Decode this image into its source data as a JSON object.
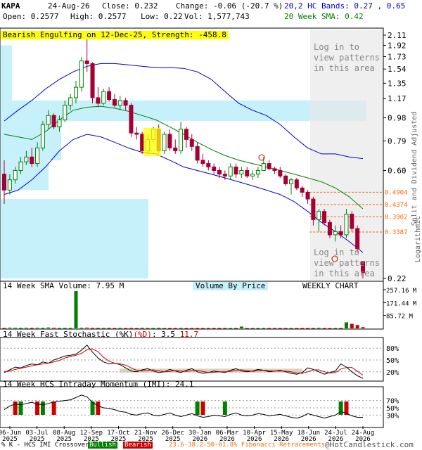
{
  "header": {
    "symbol": "KAPA",
    "date": "24-Aug-26",
    "close_label": "Close: 0.232",
    "change_label": "Change: -0.06 (-20.7 %)",
    "open_label": "Open: 0.2577",
    "high_label": "High: 0.2577",
    "low_label": "Low: 0.22",
    "vol_label": "Vol: 1,577,743",
    "bands_label": "20,2 HC Bands: 0.27 , 0.65",
    "sma_label": "20 Week SMA: 0.42",
    "pattern_banner": "Bearish Engulfing on 12-Dec-25, Strength: -458.8"
  },
  "overlay": {
    "login_top": [
      "Log in to",
      "view patterns",
      "in this area"
    ],
    "login_bottom": [
      "Log in to",
      "view patterns",
      "in this area"
    ]
  },
  "labels": {
    "right_axis_1": "Split and Dividend Adjusted",
    "right_axis_2": "Logarithmic",
    "volume_title": "14 Week SMA Volume: 7.95 M",
    "vbp_title": "Volume By Price",
    "weekly": "WEEKLY CHART",
    "stoch_title_a": "14 Week Fast Stochastic (%K)",
    "stoch_title_b": "(%D)",
    "stoch_title_c": ": 3.5",
    "stoch_title_d": "11.7",
    "imi_title": "14 Week HCS Intraday Momentum (IMI): 24.1",
    "footer_a": "% K - HCS IMI Crossover:",
    "footer_bullish": "Bullish",
    "footer_bearish": "Bearish",
    "footer_fib": "23.6-38.2-50-61.8% Fibonacci Retracements",
    "footer_copy": "@HotCandlestick.com"
  },
  "colors": {
    "bull": "#008000",
    "bear": "#a50034",
    "upper_band": "#0000cc",
    "sma": "#008000",
    "fib": "#ff6600",
    "vbp": "#c6f0fa",
    "banner": "#ffff00"
  },
  "chart_data": [
    {
      "type": "candlestick",
      "title": "KAPA",
      "scale": "log",
      "ylim": [
        0.22,
        2.11
      ],
      "y_ticks": [
        "2.11",
        "1.92",
        "1.73",
        "1.54",
        "1.35",
        "1.17",
        "0.98",
        "0.79",
        "0.60",
        "0.22"
      ],
      "fib_levels": [
        "0.4904",
        "0.4374",
        "0.3902",
        "0.3387"
      ],
      "x_ticks": [
        "06-Jun 2025",
        "03-Jul 2025",
        "08-Aug 2025",
        "12-Sep 2025",
        "17-Oct 2025",
        "21-Nov 2025",
        "26-Dec 2025",
        "30-Jan 2026",
        "06-Mar 2026",
        "10-Apr 2026",
        "15-May 2026",
        "18-Jun 2026",
        "24-Jul 2026",
        "24-Aug 2026"
      ],
      "candles": [
        {
          "o": 0.58,
          "h": 0.66,
          "l": 0.44,
          "c": 0.5
        },
        {
          "o": 0.5,
          "h": 0.58,
          "l": 0.48,
          "c": 0.55
        },
        {
          "o": 0.55,
          "h": 0.62,
          "l": 0.53,
          "c": 0.6
        },
        {
          "o": 0.6,
          "h": 0.68,
          "l": 0.58,
          "c": 0.65
        },
        {
          "o": 0.65,
          "h": 0.72,
          "l": 0.63,
          "c": 0.68
        },
        {
          "o": 0.68,
          "h": 0.74,
          "l": 0.62,
          "c": 0.64
        },
        {
          "o": 0.64,
          "h": 0.78,
          "l": 0.62,
          "c": 0.74
        },
        {
          "o": 0.74,
          "h": 0.95,
          "l": 0.72,
          "c": 0.92
        },
        {
          "o": 0.92,
          "h": 1.05,
          "l": 0.88,
          "c": 1.0
        },
        {
          "o": 1.0,
          "h": 1.02,
          "l": 0.88,
          "c": 0.9
        },
        {
          "o": 0.9,
          "h": 1.0,
          "l": 0.86,
          "c": 0.96
        },
        {
          "o": 0.96,
          "h": 1.15,
          "l": 0.94,
          "c": 1.1
        },
        {
          "o": 1.1,
          "h": 1.22,
          "l": 1.05,
          "c": 1.18
        },
        {
          "o": 1.18,
          "h": 1.38,
          "l": 1.12,
          "c": 1.3
        },
        {
          "o": 1.3,
          "h": 1.72,
          "l": 1.25,
          "c": 1.66
        },
        {
          "o": 1.66,
          "h": 2.11,
          "l": 1.5,
          "c": 1.62
        },
        {
          "o": 1.62,
          "h": 1.64,
          "l": 1.12,
          "c": 1.18
        },
        {
          "o": 1.18,
          "h": 1.3,
          "l": 1.08,
          "c": 1.12
        },
        {
          "o": 1.12,
          "h": 1.28,
          "l": 1.1,
          "c": 1.25
        },
        {
          "o": 1.25,
          "h": 1.3,
          "l": 1.14,
          "c": 1.16
        },
        {
          "o": 1.16,
          "h": 1.22,
          "l": 1.08,
          "c": 1.1
        },
        {
          "o": 1.1,
          "h": 1.2,
          "l": 1.05,
          "c": 1.15
        },
        {
          "o": 1.15,
          "h": 1.18,
          "l": 1.05,
          "c": 1.1
        },
        {
          "o": 1.1,
          "h": 1.12,
          "l": 0.82,
          "c": 0.85
        },
        {
          "o": 0.85,
          "h": 0.9,
          "l": 0.8,
          "c": 0.84
        },
        {
          "o": 0.84,
          "h": 0.86,
          "l": 0.7,
          "c": 0.72
        },
        {
          "o": 0.72,
          "h": 0.84,
          "l": 0.7,
          "c": 0.8
        },
        {
          "o": 0.8,
          "h": 0.9,
          "l": 0.78,
          "c": 0.88
        },
        {
          "o": 0.88,
          "h": 0.92,
          "l": 0.7,
          "c": 0.72
        },
        {
          "o": 0.72,
          "h": 0.86,
          "l": 0.7,
          "c": 0.84
        },
        {
          "o": 0.84,
          "h": 0.88,
          "l": 0.72,
          "c": 0.74
        },
        {
          "o": 0.74,
          "h": 0.8,
          "l": 0.7,
          "c": 0.72
        },
        {
          "o": 0.72,
          "h": 0.94,
          "l": 0.7,
          "c": 0.88
        },
        {
          "o": 0.88,
          "h": 0.9,
          "l": 0.74,
          "c": 0.8
        },
        {
          "o": 0.8,
          "h": 0.84,
          "l": 0.72,
          "c": 0.75
        },
        {
          "o": 0.75,
          "h": 0.78,
          "l": 0.64,
          "c": 0.66
        },
        {
          "o": 0.66,
          "h": 0.7,
          "l": 0.62,
          "c": 0.64
        },
        {
          "o": 0.64,
          "h": 0.66,
          "l": 0.6,
          "c": 0.62
        },
        {
          "o": 0.62,
          "h": 0.64,
          "l": 0.58,
          "c": 0.6
        },
        {
          "o": 0.6,
          "h": 0.62,
          "l": 0.56,
          "c": 0.58
        },
        {
          "o": 0.58,
          "h": 0.6,
          "l": 0.55,
          "c": 0.57
        },
        {
          "o": 0.57,
          "h": 0.64,
          "l": 0.55,
          "c": 0.62
        },
        {
          "o": 0.62,
          "h": 0.64,
          "l": 0.56,
          "c": 0.58
        },
        {
          "o": 0.58,
          "h": 0.62,
          "l": 0.56,
          "c": 0.6
        },
        {
          "o": 0.6,
          "h": 0.62,
          "l": 0.56,
          "c": 0.57
        },
        {
          "o": 0.57,
          "h": 0.6,
          "l": 0.55,
          "c": 0.58
        },
        {
          "o": 0.58,
          "h": 0.62,
          "l": 0.56,
          "c": 0.6
        },
        {
          "o": 0.6,
          "h": 0.68,
          "l": 0.6,
          "c": 0.64
        },
        {
          "o": 0.64,
          "h": 0.66,
          "l": 0.6,
          "c": 0.61
        },
        {
          "o": 0.61,
          "h": 0.62,
          "l": 0.58,
          "c": 0.6
        },
        {
          "o": 0.6,
          "h": 0.62,
          "l": 0.56,
          "c": 0.57
        },
        {
          "o": 0.57,
          "h": 0.58,
          "l": 0.52,
          "c": 0.53
        },
        {
          "o": 0.53,
          "h": 0.56,
          "l": 0.48,
          "c": 0.55
        },
        {
          "o": 0.55,
          "h": 0.56,
          "l": 0.5,
          "c": 0.51
        },
        {
          "o": 0.51,
          "h": 0.52,
          "l": 0.47,
          "c": 0.49
        },
        {
          "o": 0.49,
          "h": 0.5,
          "l": 0.44,
          "c": 0.46
        },
        {
          "o": 0.46,
          "h": 0.47,
          "l": 0.36,
          "c": 0.38
        },
        {
          "o": 0.38,
          "h": 0.42,
          "l": 0.34,
          "c": 0.41
        },
        {
          "o": 0.41,
          "h": 0.42,
          "l": 0.36,
          "c": 0.37
        },
        {
          "o": 0.37,
          "h": 0.38,
          "l": 0.32,
          "c": 0.33
        },
        {
          "o": 0.33,
          "h": 0.36,
          "l": 0.31,
          "c": 0.34
        },
        {
          "o": 0.34,
          "h": 0.36,
          "l": 0.32,
          "c": 0.33
        },
        {
          "o": 0.33,
          "h": 0.42,
          "l": 0.32,
          "c": 0.4
        },
        {
          "o": 0.4,
          "h": 0.41,
          "l": 0.34,
          "c": 0.35
        },
        {
          "o": 0.35,
          "h": 0.36,
          "l": 0.28,
          "c": 0.29
        },
        {
          "o": 0.2577,
          "h": 0.2577,
          "l": 0.22,
          "c": 0.232
        }
      ],
      "upper_band": [
        0.95,
        1.05,
        1.15,
        1.28,
        1.4,
        1.5,
        1.58,
        1.62,
        1.62,
        1.6,
        1.58,
        1.56,
        1.56,
        1.55,
        1.5,
        1.4,
        1.25,
        1.12,
        1.05,
        1.0,
        0.92,
        0.82,
        0.74,
        0.7,
        0.7,
        0.68,
        0.67
      ],
      "lower_band": [
        0.48,
        0.5,
        0.55,
        0.62,
        0.72,
        0.8,
        0.84,
        0.82,
        0.78,
        0.74,
        0.71,
        0.7,
        0.66,
        0.62,
        0.6,
        0.58,
        0.56,
        0.54,
        0.52,
        0.5,
        0.48,
        0.45,
        0.41,
        0.37,
        0.34,
        0.31,
        0.28
      ],
      "sma20": [
        0.84,
        0.82,
        0.8,
        0.86,
        0.96,
        1.05,
        1.08,
        1.09,
        1.07,
        1.04,
        1.0,
        0.96,
        0.9,
        0.84,
        0.78,
        0.73,
        0.69,
        0.66,
        0.64,
        0.62,
        0.6,
        0.58,
        0.56,
        0.54,
        0.51,
        0.47,
        0.42
      ]
    },
    {
      "type": "bar",
      "title": "14 Week SMA Volume: 7.95 M",
      "ylabel_ticks": [
        "257.16 M",
        "171.44 M",
        "85.72 M"
      ],
      "ylim": [
        0,
        257.16
      ],
      "values": [
        3,
        5,
        4,
        3,
        4,
        3,
        4,
        3,
        6,
        4,
        3,
        3,
        3,
        248,
        4,
        5,
        3,
        3,
        3,
        3,
        2,
        3,
        2,
        3,
        2,
        3,
        3,
        2,
        3,
        2,
        2,
        2,
        3,
        2,
        2,
        2,
        2,
        2,
        2,
        2,
        2,
        2,
        2,
        12,
        2,
        2,
        2,
        2,
        2,
        2,
        2,
        2,
        2,
        2,
        2,
        2,
        2,
        3,
        2,
        2,
        2,
        2,
        40,
        30,
        22,
        8
      ]
    },
    {
      "type": "line",
      "title": "14 Week Fast Stochastic",
      "y_ticks": [
        "80%",
        "50%",
        "20%"
      ],
      "ylim": [
        0,
        100
      ],
      "k": [
        18,
        25,
        32,
        30,
        36,
        40,
        38,
        45,
        42,
        50,
        55,
        60,
        62,
        65,
        75,
        88,
        70,
        55,
        45,
        40,
        42,
        38,
        30,
        22,
        20,
        25,
        28,
        22,
        18,
        20,
        26,
        22,
        18,
        24,
        28,
        20,
        16,
        18,
        22,
        20,
        18,
        24,
        28,
        22,
        20,
        22,
        26,
        24,
        20,
        22,
        24,
        20,
        16,
        14,
        18,
        30,
        26,
        20,
        14,
        18,
        22,
        40,
        32,
        20,
        10,
        3.5
      ],
      "d": [
        20,
        22,
        26,
        29,
        32,
        35,
        38,
        40,
        42,
        45,
        49,
        55,
        59,
        62,
        67,
        76,
        78,
        71,
        57,
        47,
        42,
        40,
        37,
        30,
        24,
        22,
        24,
        25,
        23,
        20,
        21,
        23,
        22,
        21,
        23,
        24,
        21,
        18,
        19,
        20,
        20,
        21,
        24,
        25,
        23,
        21,
        23,
        24,
        23,
        22,
        22,
        22,
        20,
        17,
        16,
        20,
        25,
        25,
        20,
        17,
        18,
        27,
        31,
        31,
        21,
        11.7
      ]
    },
    {
      "type": "line",
      "title": "14 Week HCS Intraday Momentum (IMI): 24.1",
      "y_ticks": [
        "70%",
        "50%",
        "30%"
      ],
      "ylim": [
        0,
        100
      ],
      "values": [
        45,
        55,
        60,
        58,
        62,
        65,
        60,
        58,
        62,
        66,
        68,
        70,
        72,
        78,
        85,
        80,
        65,
        55,
        50,
        48,
        45,
        40,
        38,
        32,
        30,
        34,
        36,
        30,
        28,
        32,
        36,
        30,
        26,
        30,
        34,
        28,
        24,
        26,
        30,
        28,
        26,
        32,
        36,
        30,
        28,
        30,
        34,
        32,
        28,
        30,
        32,
        28,
        24,
        22,
        26,
        34,
        30,
        26,
        22,
        26,
        30,
        40,
        35,
        28,
        24,
        24.1
      ]
    }
  ]
}
